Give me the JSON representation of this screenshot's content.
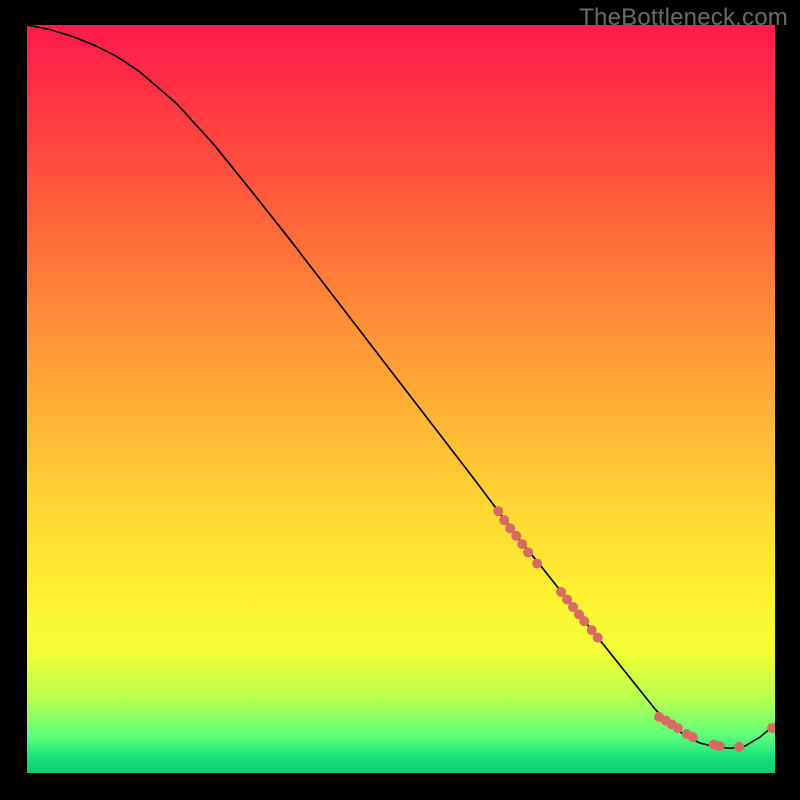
{
  "watermark": "TheBottleneck.com",
  "chart_data": {
    "type": "line",
    "title": "",
    "xlabel": "",
    "ylabel": "",
    "xlim": [
      0,
      100
    ],
    "ylim": [
      0,
      100
    ],
    "grid": false,
    "series": [
      {
        "name": "curve",
        "x": [
          0,
          3,
          6,
          9,
          12,
          15,
          20,
          25,
          30,
          35,
          40,
          45,
          50,
          55,
          60,
          63,
          66,
          69,
          72,
          74,
          76,
          78,
          80,
          82,
          84,
          86,
          88,
          90,
          92,
          94,
          96,
          98,
          100
        ],
        "y": [
          100,
          99.4,
          98.5,
          97.3,
          95.8,
          93.8,
          89.5,
          84.0,
          77.8,
          71.5,
          65.0,
          58.5,
          52.0,
          45.5,
          39.0,
          35.0,
          31.0,
          27.3,
          23.5,
          21.0,
          18.5,
          16.0,
          13.5,
          11.0,
          8.5,
          6.5,
          5.0,
          4.0,
          3.5,
          3.3,
          3.6,
          4.8,
          6.5
        ]
      }
    ],
    "marker_groups": [
      {
        "name": "dots-upper",
        "color": "#d86a64",
        "radius": 5,
        "points": [
          [
            63.0,
            35.0
          ],
          [
            63.8,
            33.8
          ],
          [
            64.6,
            32.7
          ],
          [
            65.4,
            31.7
          ],
          [
            66.2,
            30.6
          ],
          [
            67.0,
            29.5
          ],
          [
            68.2,
            28.0
          ],
          [
            71.4,
            24.2
          ],
          [
            72.2,
            23.2
          ],
          [
            73.0,
            22.2
          ],
          [
            73.8,
            21.2
          ],
          [
            74.5,
            20.3
          ],
          [
            75.5,
            19.1
          ],
          [
            76.3,
            18.1
          ]
        ]
      },
      {
        "name": "dots-valley",
        "color": "#d86a64",
        "radius": 5,
        "points": [
          [
            84.5,
            7.5
          ],
          [
            85.4,
            7.0
          ],
          [
            86.2,
            6.5
          ],
          [
            87.0,
            6.0
          ],
          [
            88.2,
            5.2
          ],
          [
            89.0,
            4.8
          ],
          [
            91.8,
            3.8
          ],
          [
            92.6,
            3.6
          ],
          [
            95.2,
            3.5
          ],
          [
            99.6,
            6.0
          ]
        ]
      }
    ]
  }
}
